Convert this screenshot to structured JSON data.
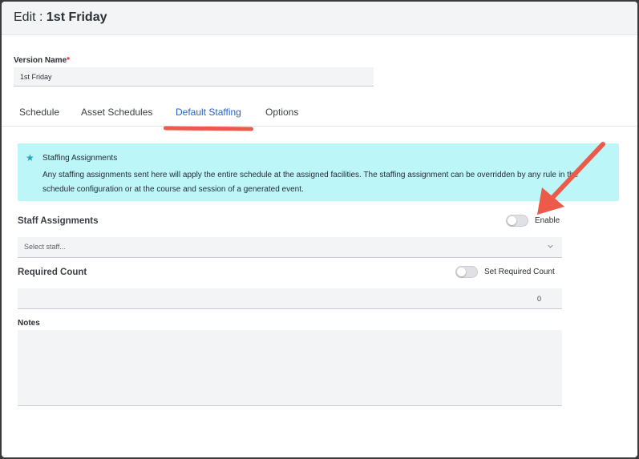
{
  "header": {
    "title_prefix": "Edit : ",
    "title_name": "1st Friday"
  },
  "version_name": {
    "label": "Version Name",
    "required_mark": "*",
    "value": "1st Friday"
  },
  "tabs": [
    {
      "label": "Schedule",
      "active": false
    },
    {
      "label": "Asset Schedules",
      "active": false
    },
    {
      "label": "Default Staffing",
      "active": true
    },
    {
      "label": "Options",
      "active": false
    }
  ],
  "info": {
    "icon": "star-icon",
    "title": "Staffing Assignments",
    "body": "Any staffing assignments sent here will apply the entire schedule at the assigned facilities. The staffing assignment can be overridden by any rule in the schedule configuration or at the course and session of a generated event."
  },
  "staff_assignments": {
    "label": "Staff Assignments",
    "toggle_label": "Enable",
    "toggle_on": false,
    "select_placeholder": "Select staff..."
  },
  "required_count": {
    "label": "Required Count",
    "toggle_label": "Set Required Count",
    "toggle_on": false,
    "value": "0"
  },
  "notes": {
    "label": "Notes",
    "value": ""
  },
  "colors": {
    "accent": "#2563c9",
    "annotation": "#ec5a4a",
    "info_bg": "#bdf6f8",
    "required": "#d9262e"
  }
}
